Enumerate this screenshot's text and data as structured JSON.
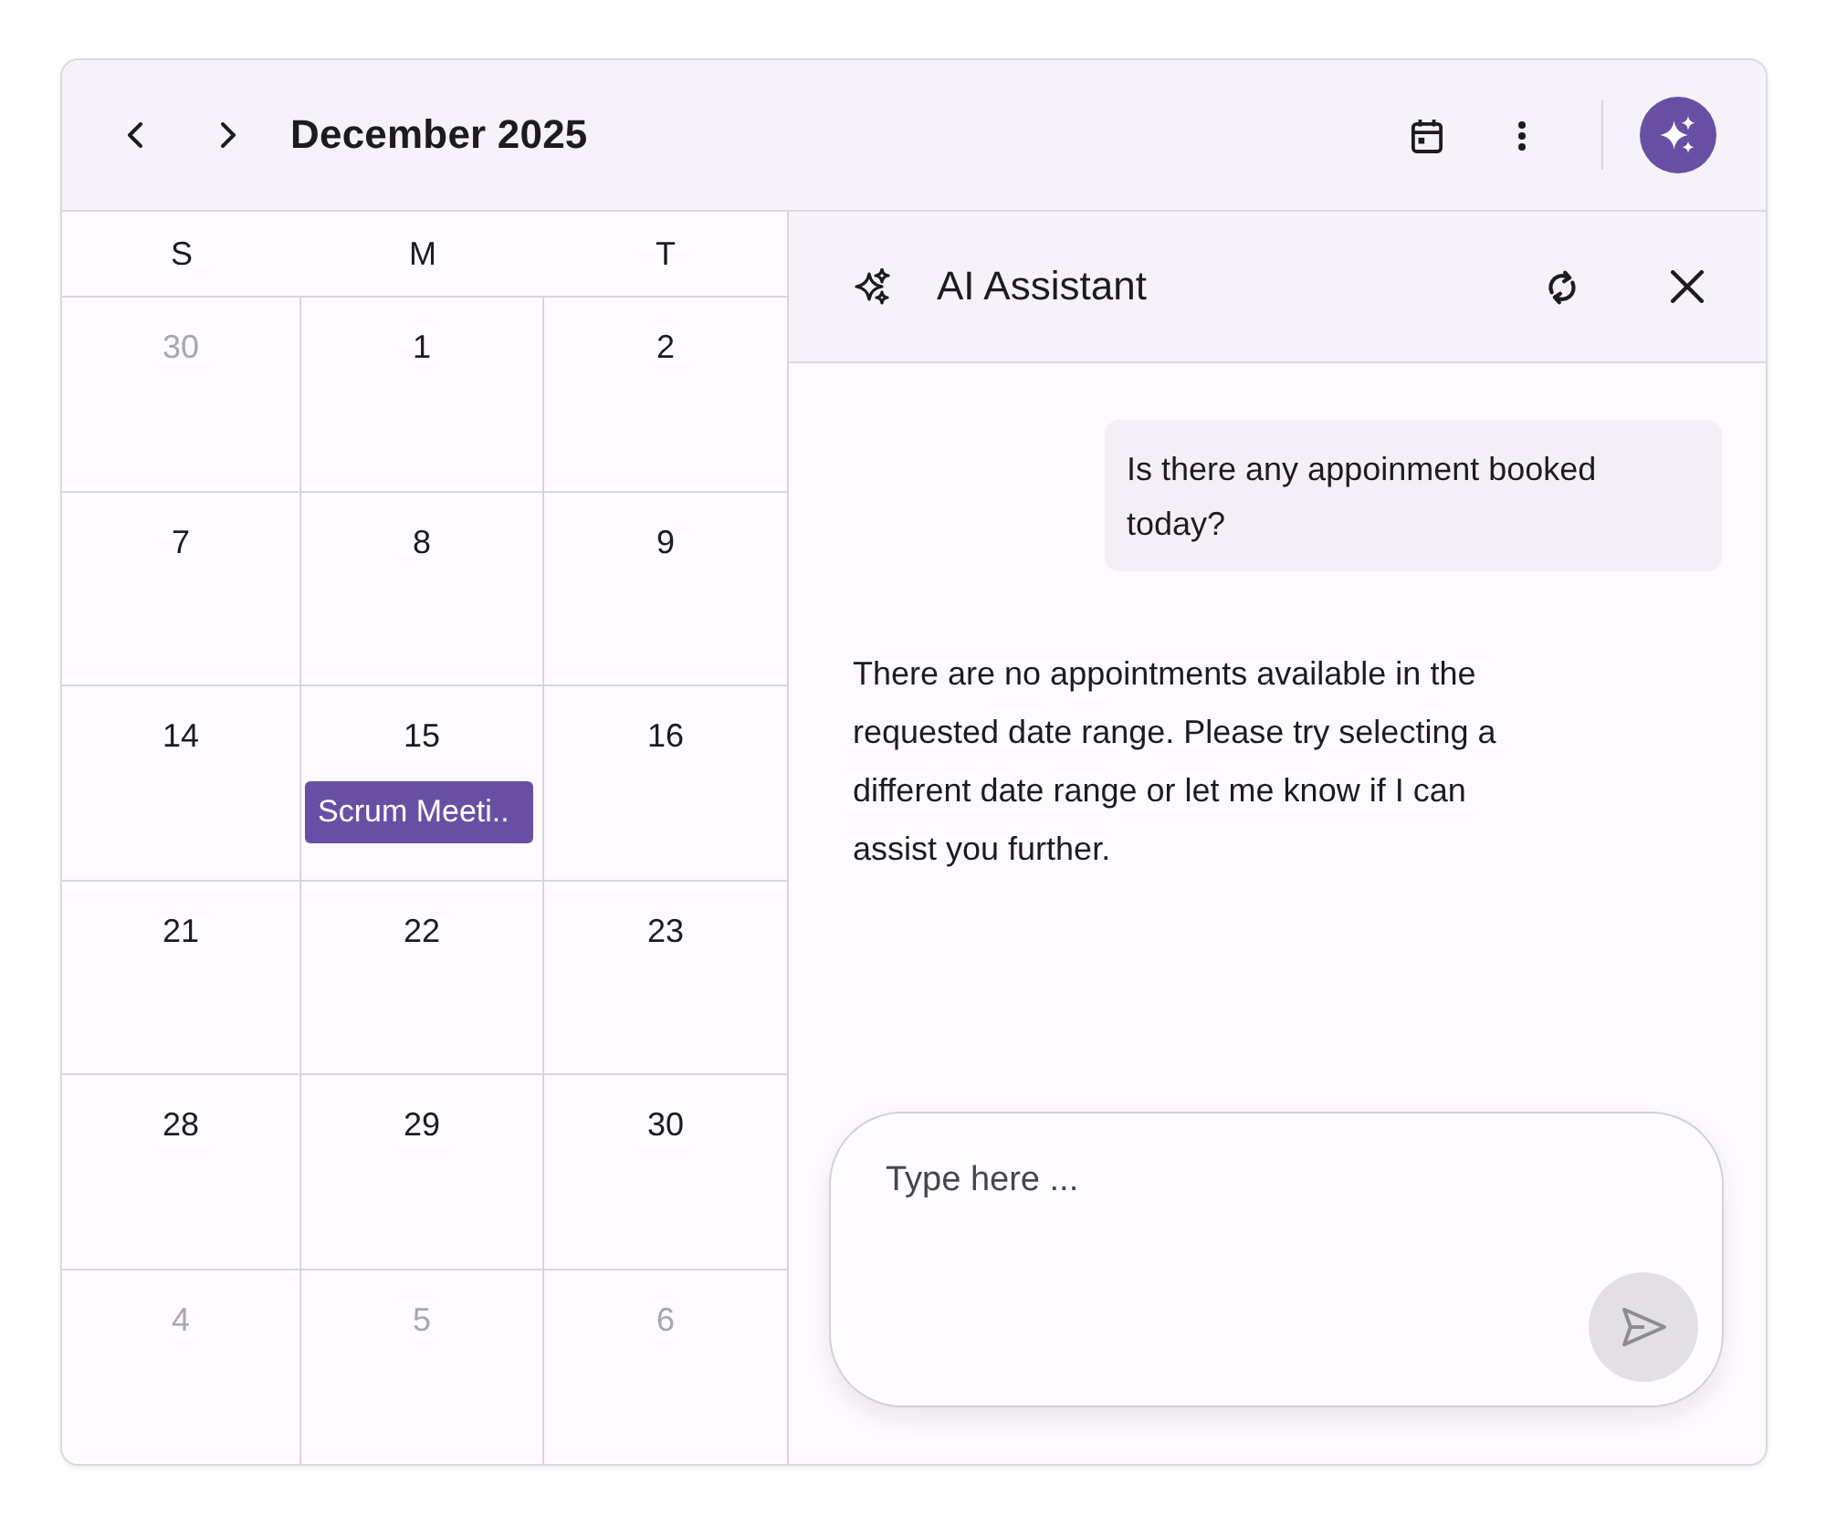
{
  "toolbar": {
    "title": "December 2025"
  },
  "calendar": {
    "weekdays": [
      "S",
      "M",
      "T"
    ],
    "weeks": [
      [
        {
          "day": "30",
          "muted": true
        },
        {
          "day": "1",
          "muted": false
        },
        {
          "day": "2",
          "muted": false
        }
      ],
      [
        {
          "day": "7",
          "muted": false
        },
        {
          "day": "8",
          "muted": false
        },
        {
          "day": "9",
          "muted": false
        }
      ],
      [
        {
          "day": "14",
          "muted": false
        },
        {
          "day": "15",
          "muted": false,
          "events": [
            {
              "title": "Scrum Meeti.."
            }
          ]
        },
        {
          "day": "16",
          "muted": false
        }
      ],
      [
        {
          "day": "21",
          "muted": false
        },
        {
          "day": "22",
          "muted": false
        },
        {
          "day": "23",
          "muted": false
        }
      ],
      [
        {
          "day": "28",
          "muted": false
        },
        {
          "day": "29",
          "muted": false
        },
        {
          "day": "30",
          "muted": false
        }
      ],
      [
        {
          "day": "4",
          "muted": true
        },
        {
          "day": "5",
          "muted": true
        },
        {
          "day": "6",
          "muted": true
        }
      ]
    ]
  },
  "assistant": {
    "title": "AI Assistant",
    "messages": [
      {
        "kind": "user",
        "text": "Is there any appoinment booked today?"
      },
      {
        "kind": "assistant",
        "text": "There are no appointments available in the requested date range. Please try selecting a different date range or let me know if I can assist you further."
      }
    ],
    "input": {
      "placeholder": "Type here ..."
    }
  }
}
